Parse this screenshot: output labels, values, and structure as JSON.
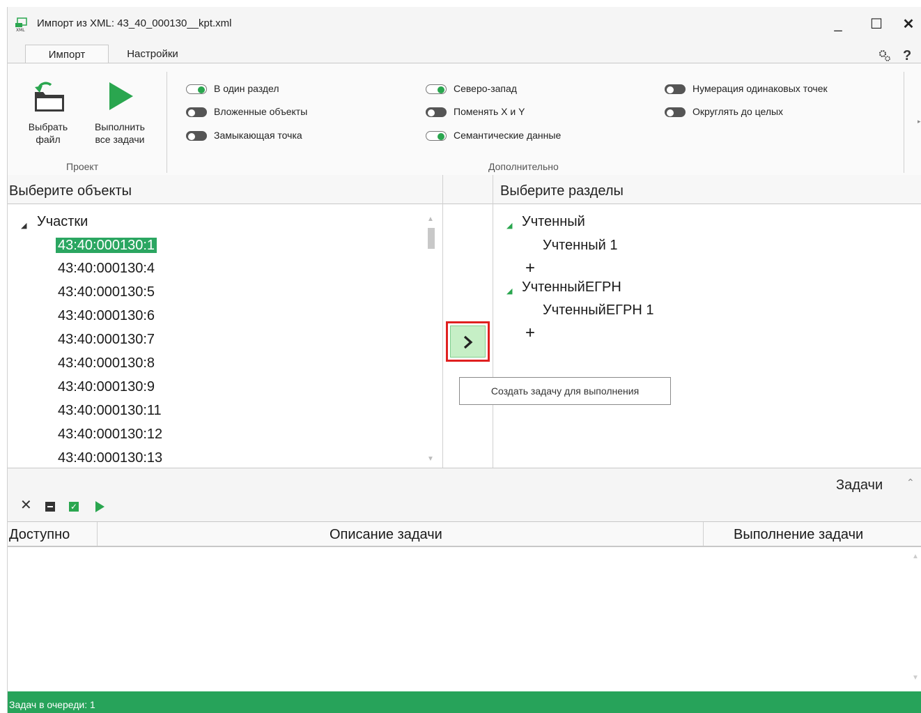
{
  "window": {
    "title": "Импорт из XML: 43_40_000130__kpt.xml",
    "controls": {
      "minimize": "_",
      "maximize": "☐",
      "close": "✕"
    }
  },
  "tabs": [
    {
      "label": "Импорт",
      "active": true
    },
    {
      "label": "Настройки",
      "active": false
    }
  ],
  "ribbon": {
    "project": {
      "select_file_label_1": "Выбрать",
      "select_file_label_2": "файл",
      "run_all_label_1": "Выполнить",
      "run_all_label_2": "все задачи",
      "group_label": "Проект"
    },
    "options": [
      {
        "label": "В один раздел",
        "on": true
      },
      {
        "label": "Вложенные объекты",
        "on": false
      },
      {
        "label": "Замыкающая точка",
        "on": false
      },
      {
        "label": "Северо-запад",
        "on": true
      },
      {
        "label": "Поменять X и Y",
        "on": false
      },
      {
        "label": "Семантические данные",
        "on": true
      },
      {
        "label": "Нумерация одинаковых точек",
        "on": false
      },
      {
        "label": "Округлять до целых",
        "on": false
      }
    ],
    "extra_group_label": "Дополнительно"
  },
  "left_panel": {
    "header": "Выберите объекты",
    "group": "Участки",
    "items": [
      "43:40:000130:1",
      "43:40:000130:4",
      "43:40:000130:5",
      "43:40:000130:6",
      "43:40:000130:7",
      "43:40:000130:8",
      "43:40:000130:9",
      "43:40:000130:11",
      "43:40:000130:12",
      "43:40:000130:13"
    ],
    "selected_index": 0
  },
  "right_panel": {
    "header": "Выберите разделы",
    "groups": [
      {
        "name": "Учтенный",
        "child": "Учтенный 1"
      },
      {
        "name": "УчтенныйЕГРН",
        "child": "УчтенныйЕГРН 1"
      }
    ],
    "add_symbol": "+"
  },
  "tooltip": "Создать задачу для выполнения",
  "tasks": {
    "title": "Задачи",
    "columns": [
      "Доступно",
      "Описание задачи",
      "Выполнение задачи"
    ]
  },
  "status": "Задач в очереди: 1",
  "colors": {
    "accent": "#2ba661",
    "status_bg": "#27a35a",
    "highlight_border": "#e02020",
    "arrow_btn_bg": "#c6efc6"
  },
  "icons": [
    "xml-file-icon",
    "select-file-icon",
    "run-all-icon",
    "settings-gear-icon",
    "help-icon",
    "create-task-arrow-icon",
    "delete-task-icon",
    "minus-icon",
    "check-icon",
    "play-icon",
    "collapse-icon"
  ]
}
